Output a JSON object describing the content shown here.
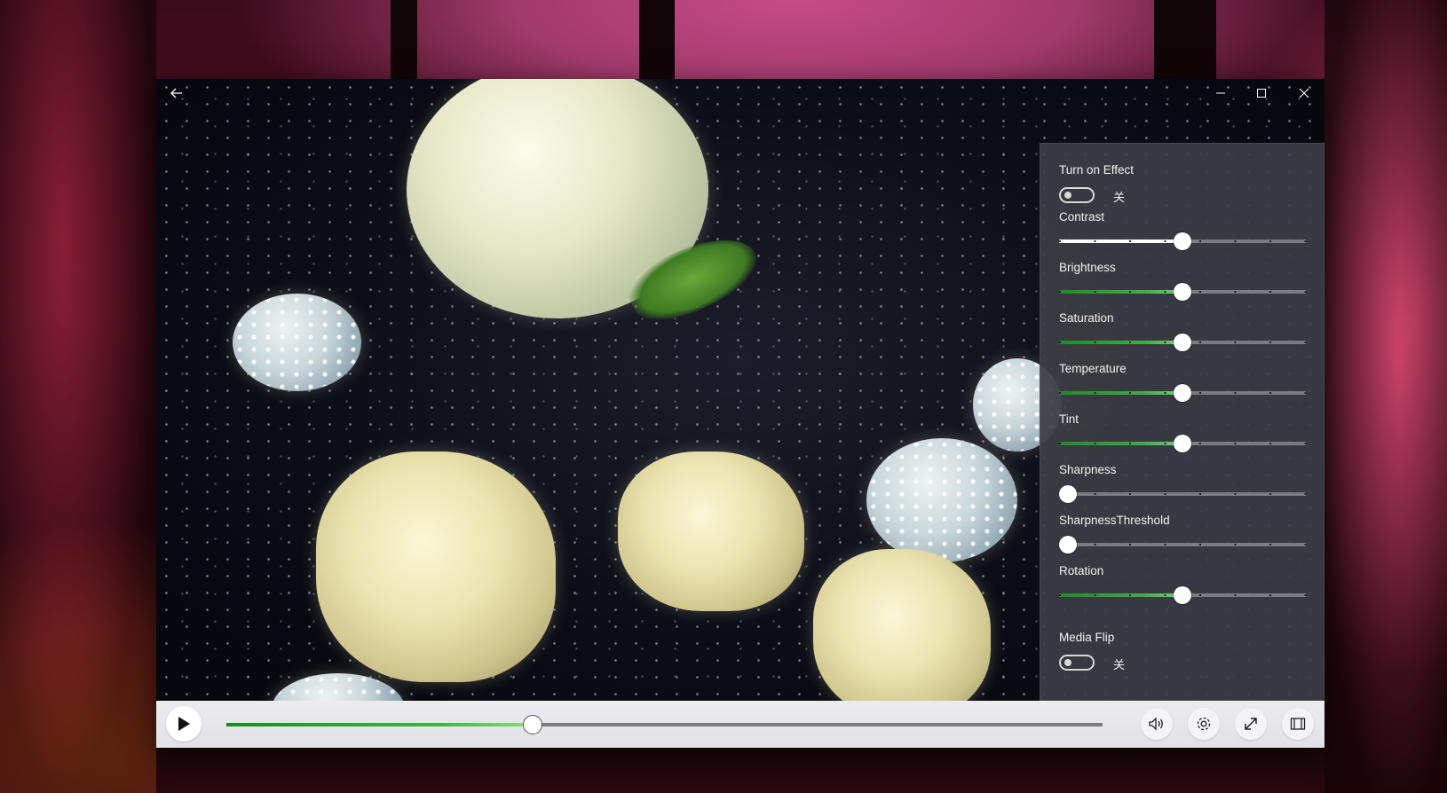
{
  "window": {
    "back_icon": "back-arrow-icon",
    "minimize_icon": "minimize-icon",
    "maximize_icon": "maximize-icon",
    "close_icon": "close-icon"
  },
  "effects_panel": {
    "turn_on_effect": {
      "label": "Turn on Effect",
      "state_text": "关",
      "on": false
    },
    "sliders": [
      {
        "label": "Contrast",
        "level": 0.5,
        "fill_color": "#ffffff"
      },
      {
        "label": "Brightness",
        "level": 0.5,
        "fill_color": "#3fae48"
      },
      {
        "label": "Saturation",
        "level": 0.5,
        "fill_color": "#3fae48"
      },
      {
        "label": "Temperature",
        "level": 0.5,
        "fill_color": "#3fae48"
      },
      {
        "label": "Tint",
        "level": 0.5,
        "fill_color": "#3fae48"
      },
      {
        "label": "Sharpness",
        "level": 0.0,
        "fill_color": "#3fae48"
      },
      {
        "label": "SharpnessThreshold",
        "level": 0.0,
        "fill_color": "#3fae48"
      },
      {
        "label": "Rotation",
        "level": 0.5,
        "fill_color": "#3fae48"
      }
    ],
    "media_flip": {
      "label": "Media Flip",
      "state_text": "关",
      "on": false
    }
  },
  "controls": {
    "play_icon": "play-icon",
    "progress": 0.35,
    "buttons": [
      "volume-icon",
      "settings-gear-icon",
      "fullscreen-icon",
      "compact-overlay-icon"
    ]
  },
  "colors": {
    "accent_green": "#3fae48",
    "control_bar": "#e6e5e9"
  }
}
